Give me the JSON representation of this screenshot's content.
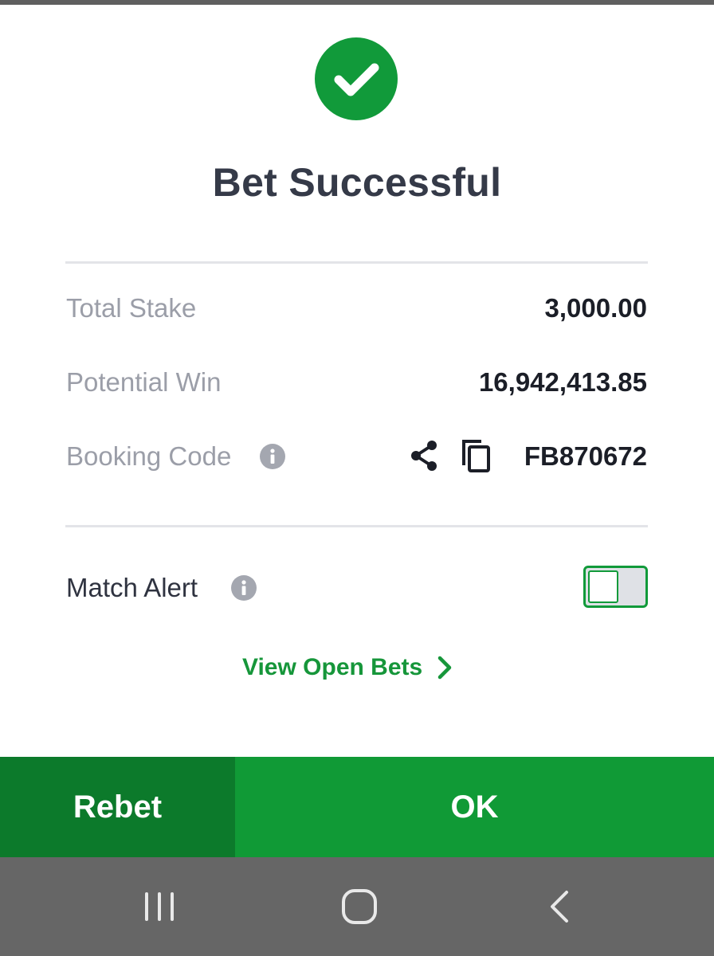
{
  "colors": {
    "brand_green": "#109a36",
    "rebet_green": "#0c7a2b",
    "link_green": "#16963a",
    "title_text": "#353a48",
    "label_gray": "#9b9ea8",
    "value_text": "#1b1e27",
    "nav_bar": "#666666"
  },
  "dialog": {
    "status_icon": "check-circle-icon",
    "title": "Bet Successful",
    "total_stake": {
      "label": "Total Stake",
      "value": "3,000.00"
    },
    "potential_win": {
      "label": "Potential Win",
      "value": "16,942,413.85"
    },
    "booking_code": {
      "label": "Booking Code",
      "value": "FB870672",
      "info_icon": "info-icon",
      "share_icon": "share-icon",
      "copy_icon": "copy-icon"
    },
    "match_alert": {
      "label": "Match Alert",
      "info_icon": "info-icon",
      "enabled": false
    },
    "view_open_bets": {
      "label": "View Open Bets",
      "icon": "chevron-right-icon"
    }
  },
  "actions": {
    "rebet_label": "Rebet",
    "ok_label": "OK"
  },
  "system_nav": {
    "recents_icon": "recents-icon",
    "home_icon": "home-icon",
    "back_icon": "back-icon"
  }
}
